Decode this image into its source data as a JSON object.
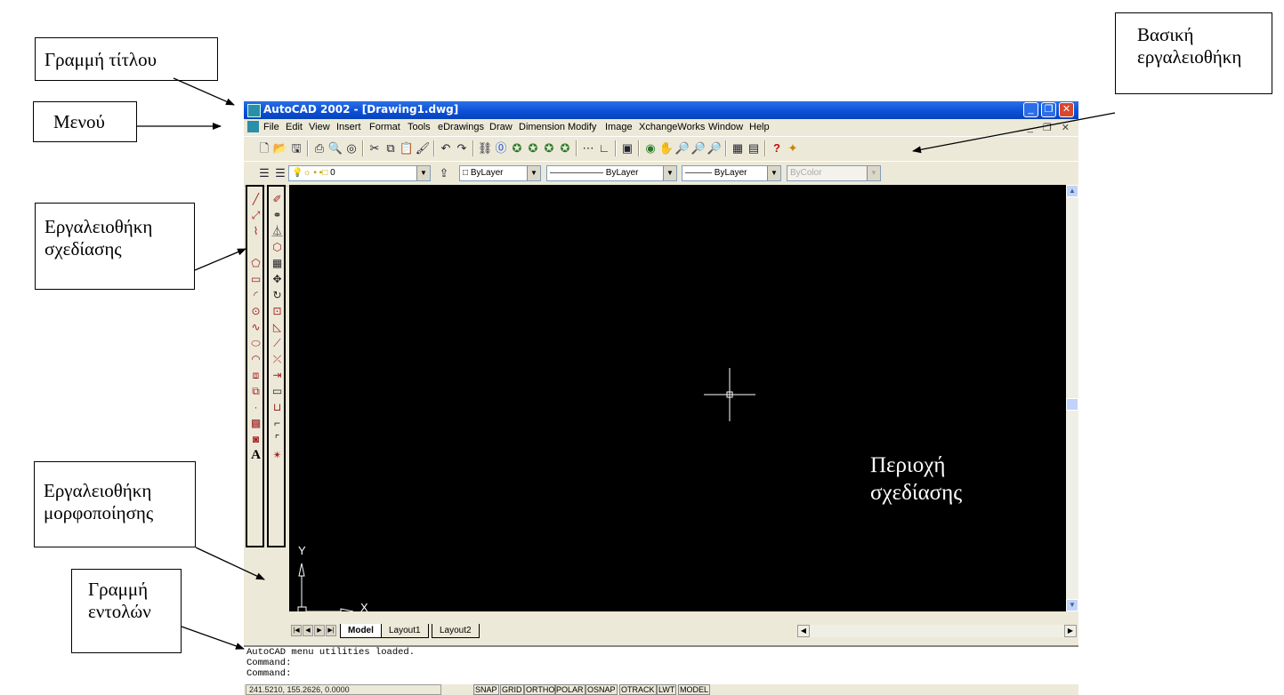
{
  "callouts": {
    "title_bar": "Γραμμή τίτλου",
    "menu": "Μενού",
    "draw_toolbar": [
      "Εργαλειοθήκη",
      "σχεδίασης"
    ],
    "modify_toolbar": [
      "Εργαλειοθήκη",
      "μορφοποίησης"
    ],
    "command_line": [
      "Γραμμή",
      "εντολών"
    ],
    "standard_toolbar": [
      "Βασική",
      "εργαλειοθήκη"
    ],
    "drawing_area": [
      "Περιοχή",
      "σχεδίασης"
    ]
  },
  "window": {
    "title": "AutoCAD 2002 - [Drawing1.dwg]",
    "menu": [
      "File",
      "Edit",
      "View",
      "Insert",
      "Format",
      "Tools",
      "eDrawings",
      "Draw",
      "Dimension",
      "Modify",
      "Image",
      "XchangeWorks",
      "Window",
      "Help"
    ]
  },
  "properties_toolbar": {
    "layer": "0",
    "color": "ByLayer",
    "linetype": "ByLayer",
    "lineweight": "ByLayer",
    "plotstyle": "ByColor"
  },
  "ucs": {
    "x_label": "X",
    "y_label": "Y"
  },
  "tabs": [
    "Model",
    "Layout1",
    "Layout2"
  ],
  "command_lines": [
    "AutoCAD menu utilities loaded.",
    "Command:",
    "Command:"
  ],
  "status": {
    "coords": "241.5210, 155.2626, 0.0000",
    "toggles": [
      "SNAP",
      "GRID",
      "ORTHO",
      "POLAR",
      "OSNAP",
      "OTRACK",
      "LWT",
      "MODEL"
    ]
  },
  "colors": {
    "title_blue": "#0a4fd6",
    "canvas": "#000000",
    "chrome": "#ece9d8"
  }
}
